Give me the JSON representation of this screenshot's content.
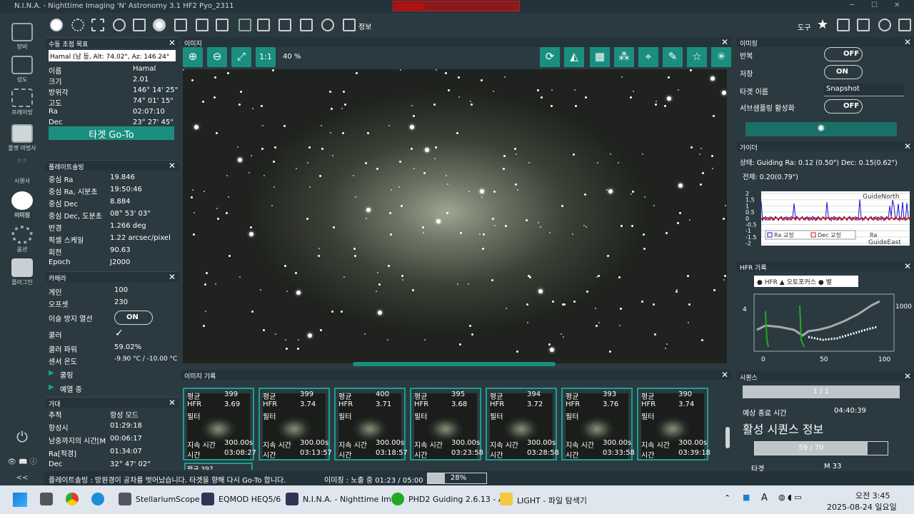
{
  "window": {
    "title": "N.I.N.A. - Nighttime Imaging 'N' Astronomy 3.1 HF2   Pyo_2311"
  },
  "nav": [
    {
      "label": "장비"
    },
    {
      "label": "성도"
    },
    {
      "label": "프레이밍"
    },
    {
      "label": "플랫 마법사"
    },
    {
      "label": "시퀀서"
    },
    {
      "label": "이미징"
    },
    {
      "label": "옵션"
    },
    {
      "label": "플러그인"
    }
  ],
  "toolbar": {
    "info_label": "정보",
    "tools_label": "도구"
  },
  "manual": {
    "header": "수동 초점 목표",
    "target_select": "Hamal (남 등, Alt: 74.02°, Az: 146.24°",
    "rows": [
      [
        "이름",
        "Hamal"
      ],
      [
        "크기",
        "2.01"
      ],
      [
        "방위각",
        "146° 14' 25\""
      ],
      [
        "고도",
        "74° 01' 15\""
      ],
      [
        "Ra",
        "02:07:10"
      ],
      [
        "Dec",
        "23° 27' 45\""
      ]
    ],
    "goto_label": "타겟 Go-To"
  },
  "plate": {
    "header": "플레이트솔빙",
    "rows": [
      [
        "중심 Ra",
        "19.846"
      ],
      [
        "중심 Ra, 시분초",
        "19:50:46"
      ],
      [
        "중심 Dec",
        "8.884"
      ],
      [
        "중심 Dec, 도분초",
        "08° 53' 03\""
      ],
      [
        "반경",
        "1.266 deg"
      ],
      [
        "픽셀 스케일",
        "1.22 arcsec/pixel"
      ],
      [
        "회전",
        "90.63"
      ],
      [
        "Epoch",
        "J2000"
      ]
    ]
  },
  "camera": {
    "header": "카메라",
    "gain_l": "게인",
    "gain": "100",
    "offset_l": "오프셋",
    "offset": "230",
    "dew_l": "이슬 방지 열선",
    "dew": "ON",
    "cooler_l": "쿨러",
    "power_l": "쿨러 파워",
    "power": "59.02%",
    "temp_l": "센서 온도",
    "temp": "-9.90 °C / -10.00 °C",
    "cooling": "쿨링",
    "warming": "예열 중"
  },
  "mount": {
    "header": "가대",
    "rows": [
      [
        "추적",
        "항성 모드"
      ],
      [
        "항성시",
        "01:29:18"
      ],
      [
        "남중까지의 시간[M",
        "00:06:17"
      ],
      [
        "Ra[적경]",
        "01:34:07"
      ],
      [
        "Dec",
        "32° 47' 02\""
      ]
    ]
  },
  "image": {
    "header": "이미지",
    "zoom": "40 %",
    "fit": "1:1"
  },
  "history": {
    "header": "이미지 기록",
    "items": [
      {
        "mean": "399",
        "hfr": "3.69",
        "exp": "300.00s",
        "time": "03:08:27"
      },
      {
        "mean": "399",
        "hfr": "3.74",
        "exp": "300.00s",
        "time": "03:13:57"
      },
      {
        "mean": "400",
        "hfr": "3.71",
        "exp": "300.00s",
        "time": "03:18:57"
      },
      {
        "mean": "395",
        "hfr": "3.68",
        "exp": "300.00s",
        "time": "03:23:58"
      },
      {
        "mean": "394",
        "hfr": "3.72",
        "exp": "300.00s",
        "time": "03:28:58"
      },
      {
        "mean": "393",
        "hfr": "3.76",
        "exp": "300.00s",
        "time": "03:33:58"
      },
      {
        "mean": "390",
        "hfr": "3.74",
        "exp": "300.00s",
        "time": "03:39:18"
      }
    ],
    "labels": {
      "mean": "평균",
      "hfr": "HFR",
      "filter": "필터",
      "exp": "지속 시간",
      "time": "시간"
    },
    "partial": "평균    397"
  },
  "imaging": {
    "header": "이미징",
    "repeat_l": "반복",
    "repeat": "OFF",
    "save_l": "저장",
    "save": "ON",
    "target_l": "타겟 이름",
    "target": "Snapshot",
    "sub_l": "서브샘플링 활성화",
    "sub": "OFF"
  },
  "guider": {
    "header": "가이더",
    "status": "상태: Guiding  Ra: 0.12 (0.50\")  Dec: 0.15(0.62\")",
    "total": "전체: 0.20(0.79\")",
    "north": "GuideNorth",
    "east": "GuideEast",
    "legend": [
      "Ra 교정",
      "Dec 교정",
      "Ra"
    ],
    "yticks": [
      "2",
      "1.5",
      "1",
      "0.5",
      "0",
      "-0.5",
      "-1",
      "-1.5",
      "-2"
    ]
  },
  "hfr": {
    "header": "HFR 기록",
    "legend": [
      "HFR",
      "오토포커스",
      "별"
    ],
    "y1": "4",
    "y2": "1000",
    "x": [
      "0",
      "50",
      "100"
    ]
  },
  "sequence": {
    "header": "시퀀스",
    "progress": "1 / 1",
    "eta_l": "예상 종료 시간",
    "eta": "04:40:39",
    "active": "활성 시퀀스 정보",
    "sub_progress": "59 / 70",
    "target_l": "타겟",
    "target": "M 33"
  },
  "status": {
    "plate": "플레이트솔빙 : 망원경이 공차를 벗어났습니다. 타겟을 향해 다시 Go-To 합니다.",
    "imaging": "이미징 : 노출 중 01:23 / 05:00",
    "pct": "28%",
    "collapse": "<<"
  },
  "taskbar": {
    "apps": [
      "StellariumScope",
      "EQMOD HEQ5/6",
      "N.I.N.A. - Nighttime Ima",
      "PHD2 Guiding 2.6.13 - A",
      "LIGHT - 파일 탐색기"
    ],
    "time": "오전 3:45",
    "date": "2025-08-24 일요일"
  },
  "colors": {
    "accent": "#1a8f80",
    "bg": "#2b3a40"
  }
}
